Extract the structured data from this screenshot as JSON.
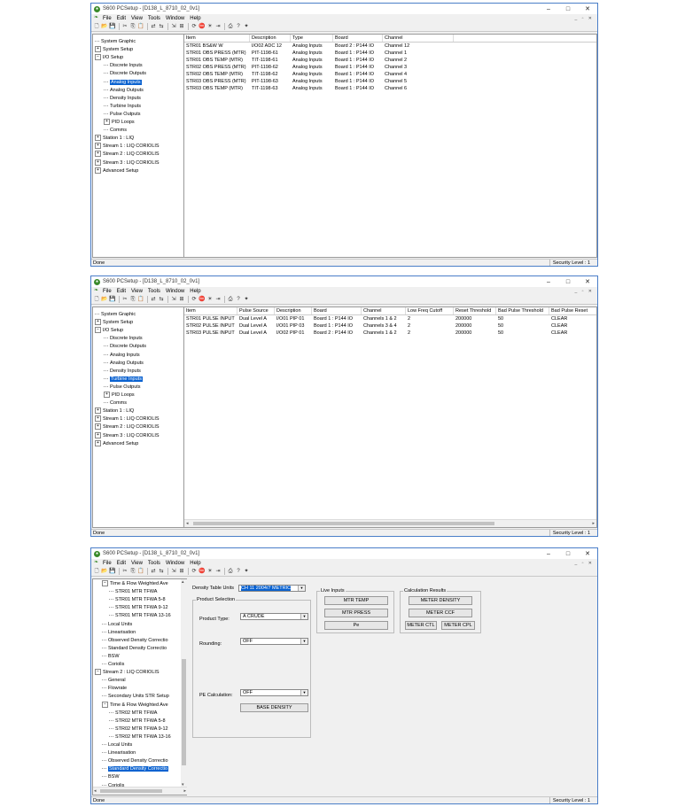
{
  "windows": [
    {
      "title": "S600 PCSetup - [D138_L_8710_02_0v1]",
      "menu": [
        "File",
        "Edit",
        "View",
        "Tools",
        "Window",
        "Help"
      ],
      "tree": [
        {
          "label": "System Graphic",
          "expand": "",
          "indent": 0
        },
        {
          "label": "System Setup",
          "expand": "+",
          "indent": 0
        },
        {
          "label": "I/O Setup",
          "expand": "-",
          "indent": 0
        },
        {
          "label": "Discrete Inputs",
          "expand": "",
          "indent": 1
        },
        {
          "label": "Discrete Outputs",
          "expand": "",
          "indent": 1
        },
        {
          "label": "Analog Inputs",
          "expand": "",
          "indent": 1,
          "selected": true
        },
        {
          "label": "Analog Outputs",
          "expand": "",
          "indent": 1
        },
        {
          "label": "Density Inputs",
          "expand": "",
          "indent": 1
        },
        {
          "label": "Turbine Inputs",
          "expand": "",
          "indent": 1
        },
        {
          "label": "Pulse Outputs",
          "expand": "",
          "indent": 1
        },
        {
          "label": "PID Loops",
          "expand": "+",
          "indent": 1
        },
        {
          "label": "Comms",
          "expand": "",
          "indent": 1
        },
        {
          "label": "Station 1 : LIQ",
          "expand": "+",
          "indent": 0
        },
        {
          "label": "Stream 1 : LIQ CORIOLIS",
          "expand": "+",
          "indent": 0
        },
        {
          "label": "Stream 2 : LIQ CORIOLIS",
          "expand": "+",
          "indent": 0
        },
        {
          "label": "Stream 3 : LIQ CORIOLIS",
          "expand": "+",
          "indent": 0
        },
        {
          "label": "Advanced Setup",
          "expand": "+",
          "indent": 0
        }
      ],
      "columns": [
        "Item",
        "Description",
        "Type",
        "Board",
        "Channel"
      ],
      "rows": [
        [
          "STR01 BS&W W",
          "I/O02 ADC 12",
          "Analog Inputs",
          "Board 2 : P144 IO",
          "Channel 12"
        ],
        [
          "STR01 OBS PRESS (MTR)",
          "PIT-1198-61",
          "Analog Inputs",
          "Board 1 : P144 IO",
          "Channel 1"
        ],
        [
          "STR01 OBS TEMP (MTR)",
          "TIT-1198-61",
          "Analog Inputs",
          "Board 1 : P144 IO",
          "Channel 2"
        ],
        [
          "STR02 OBS PRESS (MTR)",
          "PIT-1198-62",
          "Analog Inputs",
          "Board 1 : P144 IO",
          "Channel 3"
        ],
        [
          "STR02 OBS TEMP (MTR)",
          "TIT-1198-62",
          "Analog Inputs",
          "Board 1 : P144 IO",
          "Channel 4"
        ],
        [
          "STR03 OBS PRESS (MTR)",
          "PIT-1198-63",
          "Analog Inputs",
          "Board 1 : P144 IO",
          "Channel 5"
        ],
        [
          "STR03 OBS TEMP (MTR)",
          "TIT-1198-63",
          "Analog Inputs",
          "Board 1 : P144 IO",
          "Channel 6"
        ]
      ],
      "status": "Done",
      "security": "Security Level : 1"
    },
    {
      "title": "S600 PCSetup - [D138_L_8710_02_0v1]",
      "menu": [
        "File",
        "Edit",
        "View",
        "Tools",
        "Window",
        "Help"
      ],
      "tree": [
        {
          "label": "System Graphic",
          "expand": "",
          "indent": 0
        },
        {
          "label": "System Setup",
          "expand": "+",
          "indent": 0
        },
        {
          "label": "I/O Setup",
          "expand": "-",
          "indent": 0
        },
        {
          "label": "Discrete Inputs",
          "expand": "",
          "indent": 1
        },
        {
          "label": "Discrete Outputs",
          "expand": "",
          "indent": 1
        },
        {
          "label": "Analog Inputs",
          "expand": "",
          "indent": 1
        },
        {
          "label": "Analog Outputs",
          "expand": "",
          "indent": 1
        },
        {
          "label": "Density Inputs",
          "expand": "",
          "indent": 1
        },
        {
          "label": "Turbine Inputs",
          "expand": "",
          "indent": 1,
          "selected": true
        },
        {
          "label": "Pulse Outputs",
          "expand": "",
          "indent": 1
        },
        {
          "label": "PID Loops",
          "expand": "+",
          "indent": 1
        },
        {
          "label": "Comms",
          "expand": "",
          "indent": 1
        },
        {
          "label": "Station 1 : LIQ",
          "expand": "+",
          "indent": 0
        },
        {
          "label": "Stream 1 : LIQ CORIOLIS",
          "expand": "+",
          "indent": 0
        },
        {
          "label": "Stream 2 : LIQ CORIOLIS",
          "expand": "+",
          "indent": 0
        },
        {
          "label": "Stream 3 : LIQ CORIOLIS",
          "expand": "+",
          "indent": 0
        },
        {
          "label": "Advanced Setup",
          "expand": "+",
          "indent": 0
        }
      ],
      "columns": [
        "Item",
        "Pulse Source",
        "Description",
        "Board",
        "Channel",
        "Low Freq Cutoff",
        "Reset Threshold",
        "Bad Pulse Threshold",
        "Bad Pulse Reset"
      ],
      "rows": [
        [
          "STR01 PULSE INPUT",
          "Dual Level A",
          "I/O01 PIP 01",
          "Board 1 : P144 IO",
          "Channels 1 & 2",
          "2",
          "200000",
          "50",
          "CLEAR"
        ],
        [
          "STR02 PULSE INPUT",
          "Dual Level A",
          "I/O01 PIP 03",
          "Board 1 : P144 IO",
          "Channels 3 & 4",
          "2",
          "200000",
          "50",
          "CLEAR"
        ],
        [
          "STR03 PULSE INPUT",
          "Dual Level A",
          "I/O02 PIP 01",
          "Board 2 : P144 IO",
          "Channels 1 & 2",
          "2",
          "200000",
          "50",
          "CLEAR"
        ]
      ],
      "status": "Done",
      "security": "Security Level : 1"
    },
    {
      "title": "S600 PCSetup - [D138_L_8710_02_0v1]",
      "menu": [
        "File",
        "Edit",
        "View",
        "Tools",
        "Window",
        "Help"
      ],
      "tree": [
        {
          "label": "Time & Flow Weighted Ave",
          "expand": "-",
          "indent": 1
        },
        {
          "label": "STR01 MTR TFWA",
          "expand": "",
          "indent": 2
        },
        {
          "label": "STR01 MTR TFWA 5-8",
          "expand": "",
          "indent": 2
        },
        {
          "label": "STR01 MTR TFWA 9-12",
          "expand": "",
          "indent": 2
        },
        {
          "label": "STR01 MTR TFWA 13-16",
          "expand": "",
          "indent": 2
        },
        {
          "label": "Local Units",
          "expand": "",
          "indent": 1
        },
        {
          "label": "Linearisation",
          "expand": "",
          "indent": 1
        },
        {
          "label": "Observed Density Correctio",
          "expand": "",
          "indent": 1
        },
        {
          "label": "Standard Density Correctio",
          "expand": "",
          "indent": 1
        },
        {
          "label": "BSW",
          "expand": "",
          "indent": 1
        },
        {
          "label": "Coriolis",
          "expand": "",
          "indent": 1
        },
        {
          "label": "Stream 2 : LIQ CORIOLIS",
          "expand": "-",
          "indent": 0
        },
        {
          "label": "General",
          "expand": "",
          "indent": 1
        },
        {
          "label": "Flowrate",
          "expand": "",
          "indent": 1
        },
        {
          "label": "Secondary Units STR Setup",
          "expand": "",
          "indent": 1
        },
        {
          "label": "Time & Flow Weighted Ave",
          "expand": "-",
          "indent": 1
        },
        {
          "label": "STR02 MTR TFWA",
          "expand": "",
          "indent": 2
        },
        {
          "label": "STR02 MTR TFWA 5-8",
          "expand": "",
          "indent": 2
        },
        {
          "label": "STR02 MTR TFWA 9-12",
          "expand": "",
          "indent": 2
        },
        {
          "label": "STR02 MTR TFWA 13-16",
          "expand": "",
          "indent": 2
        },
        {
          "label": "Local Units",
          "expand": "",
          "indent": 1
        },
        {
          "label": "Linearisation",
          "expand": "",
          "indent": 1
        },
        {
          "label": "Observed Density Correctio",
          "expand": "",
          "indent": 1
        },
        {
          "label": "Standard Density Correctio",
          "expand": "",
          "indent": 1,
          "selected": true
        },
        {
          "label": "BSW",
          "expand": "",
          "indent": 1
        },
        {
          "label": "Coriolis",
          "expand": "",
          "indent": 1
        }
      ],
      "form": {
        "density_table_label": "Density Table Units",
        "density_table_value": "CH 11 2004/7 METRIC",
        "product_selection_title": "Product Selection",
        "product_type_label": "Product Type:",
        "product_type_value": "A CRUDE",
        "rounding_label": "Rounding:",
        "rounding_value": "OFF",
        "pe_calc_label": "PE Calculation:",
        "pe_calc_value": "OFF",
        "base_density_button": "BASE DENSITY",
        "live_inputs_title": "Live Inputs",
        "live_buttons": [
          "MTR TEMP",
          "MTR PRESS",
          "Pe"
        ],
        "calc_results_title": "Calculation Results",
        "meter_density_button": "METER DENSITY",
        "meter_ccf_button": "METER CCF",
        "meter_ctl_button": "METER CTL",
        "meter_cpl_button": "METER CPL"
      },
      "status": "Done",
      "security": "Security Level : 1"
    }
  ]
}
